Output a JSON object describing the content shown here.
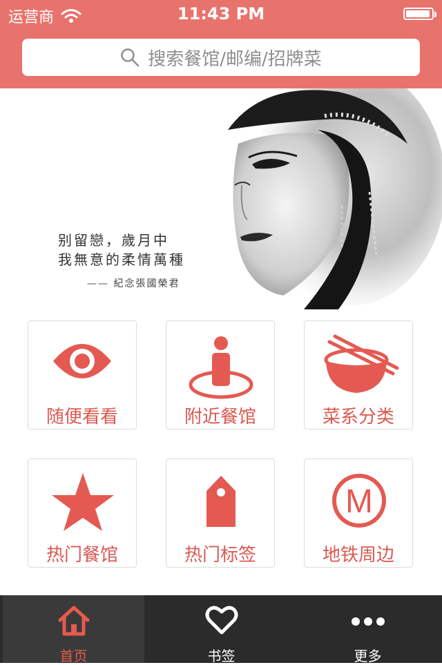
{
  "status_bar": {
    "carrier": "运营商",
    "time": "11:43 PM",
    "battery_level": 0.95
  },
  "search": {
    "placeholder": "搜索餐馆/邮编/招牌菜",
    "icon": "search-icon"
  },
  "banner": {
    "poem_line1": "别留戀，歲月中",
    "poem_line2": "我無意的柔情萬種",
    "signature": "—— 紀念張國榮君"
  },
  "grid": [
    {
      "label": "随便看看",
      "icon": "eye-icon"
    },
    {
      "label": "附近餐馆",
      "icon": "location-person-icon"
    },
    {
      "label": "菜系分类",
      "icon": "bowl-chopsticks-icon"
    },
    {
      "label": "热门餐馆",
      "icon": "star-icon"
    },
    {
      "label": "热门标签",
      "icon": "tag-icon"
    },
    {
      "label": "地铁周边",
      "icon": "metro-icon"
    }
  ],
  "tabs": [
    {
      "label": "首页",
      "icon": "home-icon",
      "active": true
    },
    {
      "label": "书签",
      "icon": "heart-icon",
      "active": false
    },
    {
      "label": "更多",
      "icon": "more-icon",
      "active": false
    }
  ],
  "colors": {
    "brand": "#e8736c",
    "accent": "#d95a52",
    "tabbar": "#2b2b2b",
    "tab_active": "#e55b4c"
  }
}
